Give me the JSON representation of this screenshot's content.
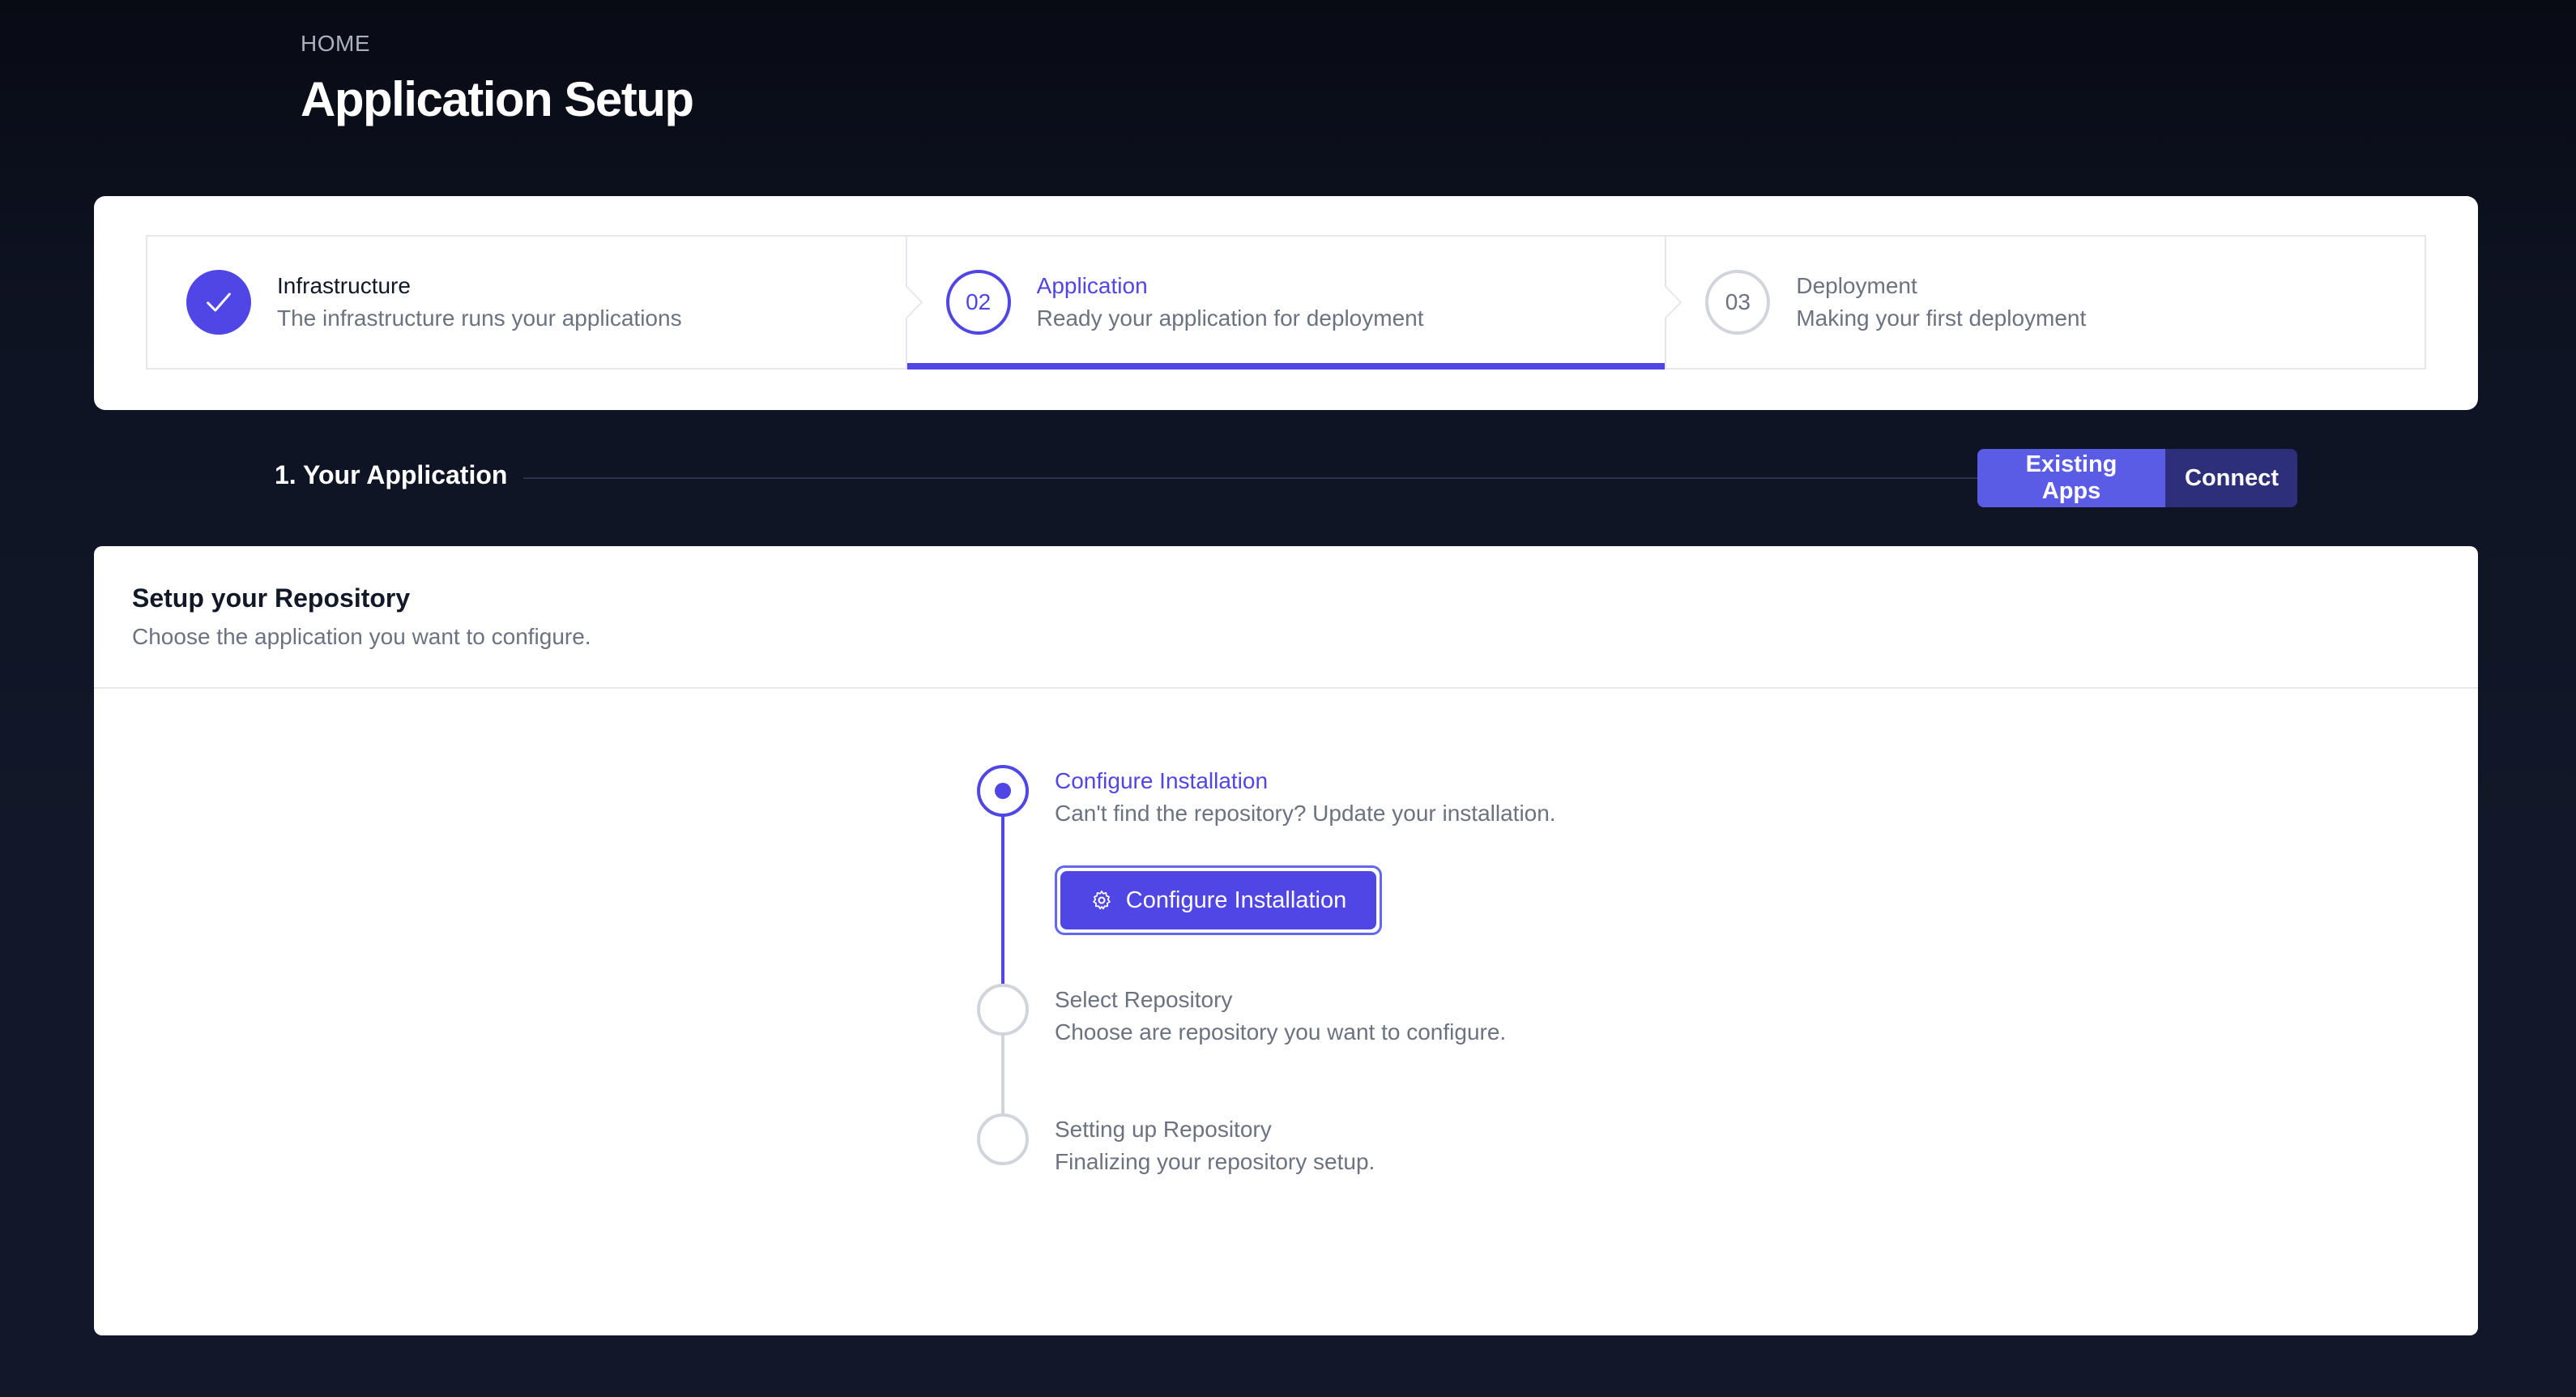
{
  "breadcrumb": "HOME",
  "page_title": "Application Setup",
  "steps": [
    {
      "number": "",
      "title": "Infrastructure",
      "subtitle": "The infrastructure runs your applications",
      "state": "complete"
    },
    {
      "number": "02",
      "title": "Application",
      "subtitle": "Ready your application for deployment",
      "state": "current"
    },
    {
      "number": "03",
      "title": "Deployment",
      "subtitle": "Making your first deployment",
      "state": "upcoming"
    }
  ],
  "section": {
    "title": "1. Your Application",
    "toggle": {
      "active_label": "Existing Apps",
      "inactive_label": "Connect"
    }
  },
  "repo_card": {
    "title": "Setup your Repository",
    "subtitle": "Choose the application you want to configure.",
    "timeline": [
      {
        "title": "Configure Installation",
        "subtitle": "Can't find the repository? Update your installation.",
        "state": "current"
      },
      {
        "title": "Select Repository",
        "subtitle": "Choose are repository you want to configure.",
        "state": "upcoming"
      },
      {
        "title": "Setting up Repository",
        "subtitle": "Finalizing your repository setup.",
        "state": "upcoming"
      }
    ],
    "configure_button_label": "Configure Installation"
  },
  "colors": {
    "accent": "#4f46e5",
    "toggle_active": "#5b5ce6",
    "toggle_inactive": "#2e2f7a",
    "background": "#111829"
  },
  "icons": [
    "check-icon",
    "gear-icon",
    "chevron-right-icon"
  ]
}
